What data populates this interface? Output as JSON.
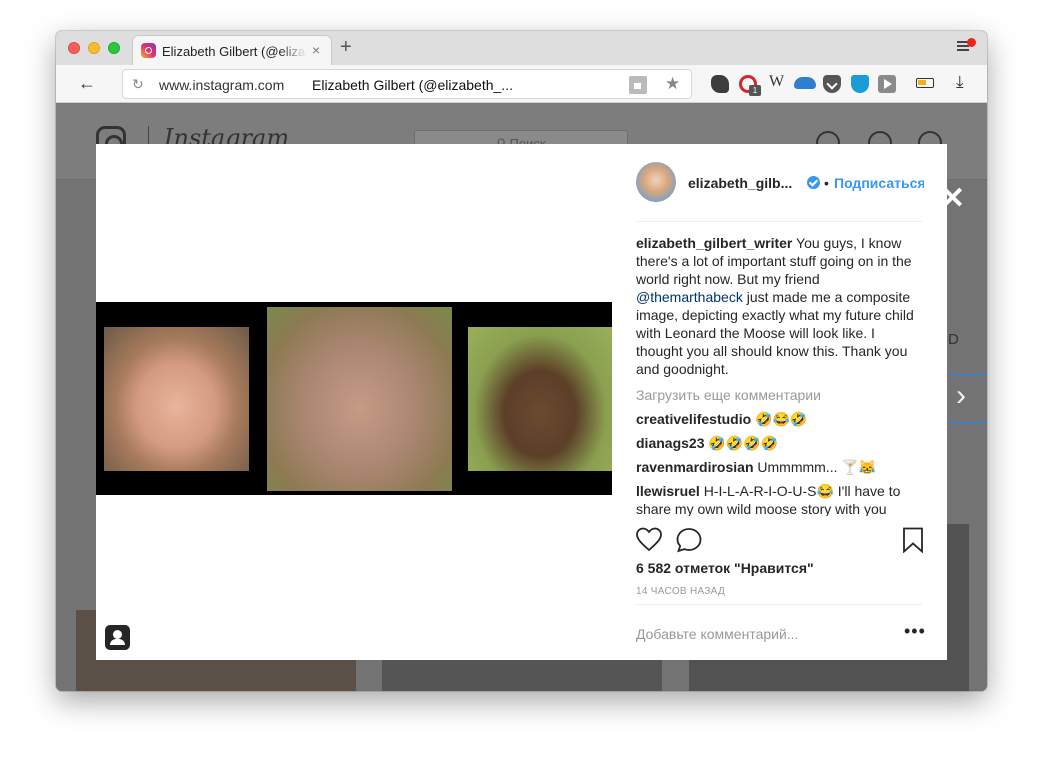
{
  "browser": {
    "tab_title": "Elizabeth Gilbert (@elizabeth_gilbert_writer)",
    "tab_close": "×",
    "new_tab": "+",
    "back": "←",
    "reload": "↻",
    "url_domain": "www.instagram.com",
    "url_page_title": "Elizabeth Gilbert (@elizabeth_...",
    "star": "★",
    "ext_w": "W",
    "ext_badge": "1",
    "download": "⤓"
  },
  "instagram_bg": {
    "wordmark": "Instagram",
    "search_placeholder": "⚲ Поиск",
    "side_label": "D"
  },
  "modal": {
    "close": "✕",
    "next": "›",
    "author": {
      "username": "elizabeth_gilb...",
      "separator": "•",
      "follow_label": "Подписаться"
    },
    "caption": {
      "user": "elizabeth_gilbert_writer",
      "text_1": " You guys, I know there's a lot of important stuff going on in the world right now. But my friend ",
      "mention": "@themarthabeck",
      "text_2": " just made me a composite image, depicting exactly what my future child with Leonard the Moose will look like. I thought you all should know this. Thank you and goodnight."
    },
    "load_more": "Загрузить еще комментарии",
    "comments": [
      {
        "user": "creativelifestudio",
        "text": " 🤣😂🤣"
      },
      {
        "user": "dianags23",
        "text": " 🤣🤣🤣🤣"
      },
      {
        "user": "ravenmardirosian",
        "text": " Ummmmm... 🍸😹"
      },
      {
        "user": "llewisruel",
        "text": " H-I-L-A-R-I-O-U-S😂 I'll have to share my own wild moose story with you"
      }
    ],
    "likes": "6 582 отметок \"Нравится\"",
    "time_ago": "14 ЧАСОВ НАЗАД",
    "add_comment_placeholder": "Добавьте комментарий...",
    "more": "•••"
  },
  "colors": {
    "link_blue": "#3897f0",
    "mention_blue": "#003569",
    "overlay": "#737373"
  }
}
